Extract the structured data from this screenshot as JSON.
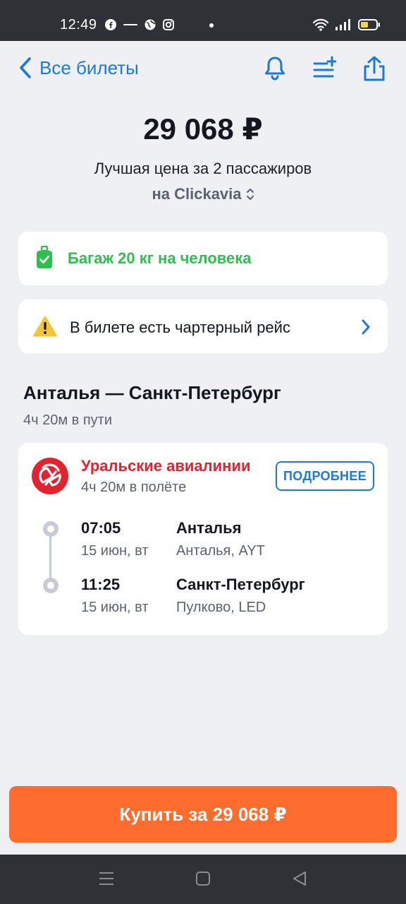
{
  "status_bar": {
    "time": "12:49",
    "icons": [
      "facebook-icon",
      "app-icon",
      "globe-icon",
      "instagram-icon",
      "wifi-icon",
      "signal-icon",
      "battery-icon"
    ]
  },
  "nav": {
    "back_label": "Все билеты",
    "icons": [
      "bell-icon",
      "add-list-icon",
      "share-icon"
    ]
  },
  "offer": {
    "price": "29 068 ₽",
    "subtitle": "Лучшая цена за 2 пассажиров",
    "agency": "на Clickavia"
  },
  "baggage": {
    "text": "Багаж 20 кг на человека"
  },
  "charter": {
    "text": "В билете есть чартерный рейс"
  },
  "route": {
    "title": "Анталья — Санкт-Петербург",
    "duration": "4ч 20м в пути"
  },
  "flight": {
    "airline": "Уральские авиалинии",
    "flight_duration": "4ч 20м в полёте",
    "details_label": "ПОДРОБНЕЕ",
    "departure": {
      "time": "07:05",
      "date": "15 июн, вт",
      "city": "Анталья",
      "airport": "Анталья, AYT"
    },
    "arrival": {
      "time": "11:25",
      "date": "15 июн, вт",
      "city": "Санкт-Петербург",
      "airport": "Пулково, LED"
    }
  },
  "buy_button": {
    "label": "Купить за 29 068 ₽"
  },
  "colors": {
    "accent": "#1a7ad9",
    "buy": "#ff6d2e",
    "baggage": "#2fbf4f",
    "airline": "#e2232f",
    "background": "#eef0f4"
  }
}
